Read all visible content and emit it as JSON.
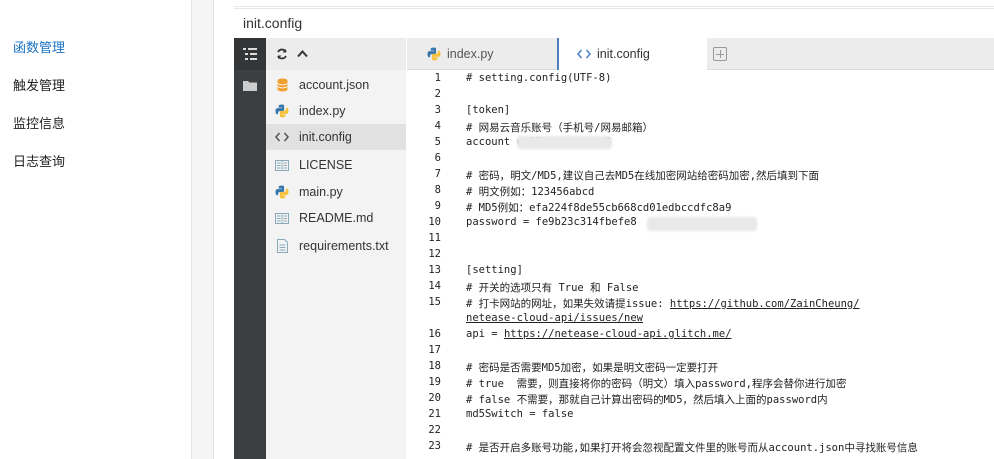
{
  "nav": {
    "items": [
      {
        "label": "函数管理",
        "active": true
      },
      {
        "label": "触发管理",
        "active": false
      },
      {
        "label": "监控信息",
        "active": false
      },
      {
        "label": "日志查询",
        "active": false
      }
    ]
  },
  "panel": {
    "title": "init.config"
  },
  "tree": {
    "files": [
      {
        "name": "account.json",
        "icon": "database-icon"
      },
      {
        "name": "index.py",
        "icon": "python-icon"
      },
      {
        "name": "init.config",
        "icon": "code-icon",
        "active": true
      },
      {
        "name": "LICENSE",
        "icon": "document-icon"
      },
      {
        "name": "main.py",
        "icon": "python-icon"
      },
      {
        "name": "README.md",
        "icon": "document-icon"
      },
      {
        "name": "requirements.txt",
        "icon": "file-icon"
      }
    ]
  },
  "tabs": [
    {
      "label": "index.py",
      "icon": "python-icon",
      "active": false
    },
    {
      "label": "init.config",
      "icon": "code-icon",
      "active": true
    }
  ],
  "editor": {
    "lines": [
      {
        "n": "1",
        "text": "# setting.config(UTF-8)"
      },
      {
        "n": "2",
        "text": ""
      },
      {
        "n": "3",
        "text": "[token]"
      },
      {
        "n": "4",
        "text": "# 网易云音乐账号（手机号/网易邮箱）"
      },
      {
        "n": "5",
        "text": "account = 15          3"
      },
      {
        "n": "6",
        "text": ""
      },
      {
        "n": "7",
        "text": "# 密码，明文/MD5,建议自己去MD5在线加密网站给密码加密,然后填到下面"
      },
      {
        "n": "8",
        "text": "# 明文例如：123456abcd"
      },
      {
        "n": "9",
        "text": "# MD5例如：efa224f8de55cb668cd01edbccdfc8a9"
      },
      {
        "n": "10",
        "text": "password = fe9b23c314fbefe8"
      },
      {
        "n": "11",
        "text": ""
      },
      {
        "n": "12",
        "text": ""
      },
      {
        "n": "13",
        "text": "[setting]"
      },
      {
        "n": "14",
        "text": "# 开关的选项只有 True 和 False"
      },
      {
        "n": "15",
        "text": "# 打卡网站的网址，如果失效请提issue: ",
        "link": "https://github.com/ZainCheung/"
      },
      {
        "n": "",
        "text": "",
        "link": "netease-cloud-api/issues/new"
      },
      {
        "n": "16",
        "text": "api = ",
        "link": "https://netease-cloud-api.glitch.me/"
      },
      {
        "n": "17",
        "text": ""
      },
      {
        "n": "18",
        "text": "# 密码是否需要MD5加密，如果是明文密码一定要打开"
      },
      {
        "n": "19",
        "text": "# true  需要，则直接将你的密码（明文）填入password,程序会替你进行加密"
      },
      {
        "n": "20",
        "text": "# false 不需要，那就自己计算出密码的MD5，然后填入上面的password内"
      },
      {
        "n": "21",
        "text": "md5Switch = false"
      },
      {
        "n": "22",
        "text": ""
      },
      {
        "n": "23",
        "text": "# 是否开启多账号功能,如果打开将会忽视配置文件里的账号而从account.json中寻找账号信息"
      }
    ]
  },
  "colors": {
    "nav_active": "#1a73c7",
    "icon_strip": "#3c3f41",
    "tab_active_border": "#4a7fc1",
    "python_blue": "#3776ab",
    "python_yellow": "#f7c23b",
    "database_orange": "#f0a030"
  }
}
